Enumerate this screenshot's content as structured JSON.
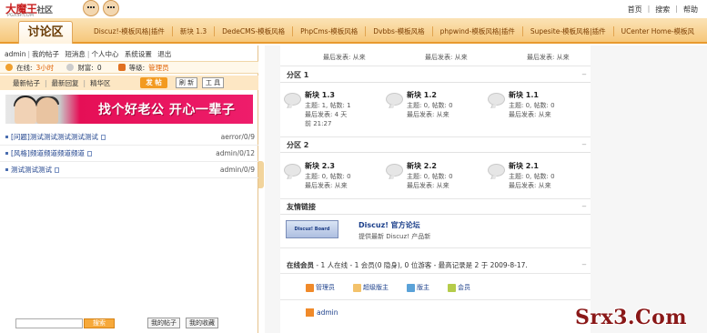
{
  "site": {
    "logo_text": "大魔王",
    "logo_sub": "社区",
    "logo_url": "PGXSP.COM",
    "top_links": [
      "首页",
      "搜索",
      "帮助"
    ]
  },
  "nav": {
    "home_tab": "讨论区",
    "items": [
      "Discuz!-模板风格|插件",
      "新块 1.3",
      "DedeCMS-模板风格",
      "PhpCms-模板风格",
      "Dvbbs-模板风格",
      "phpwind-模板风格|插件",
      "Supesite-模板风格|插件",
      "UCenter Home-模板风"
    ]
  },
  "sidebar": {
    "user_links": [
      "admin",
      "我的帖子",
      "短消息",
      "个人中心",
      "系统设置",
      "退出"
    ],
    "online_label": "在线:",
    "online_value": "3小时",
    "wealth_label": "财富:",
    "wealth_value": "0",
    "level_label": "等级:",
    "level_value": "管理员",
    "tabs": [
      "最新帖子",
      "最新回复",
      "精华区"
    ],
    "post_button": "发 帖",
    "refresh_button": "刷 新",
    "tools_button": "工 具",
    "banner_slogan": "找个好老公 开心一辈子",
    "threads": [
      {
        "title": "[问题]测试测试测试测试测试",
        "author": "aerror/0/9"
      },
      {
        "title": "[风格]频道频道频道频道",
        "author": "admin/0/12"
      },
      {
        "title": "测试测试测试",
        "author": "admin/0/9"
      }
    ],
    "search_placeholder": "",
    "search_button": "搜索",
    "my_posts_button": "我的帖子",
    "my_favorites_button": "我的收藏"
  },
  "content": {
    "top_rows": [
      {
        "line1": "最后发表: 从来"
      },
      {
        "line1": "最后发表: 从来"
      },
      {
        "line1": "最后发表: 从来"
      }
    ],
    "sections": [
      {
        "title": "分区 1",
        "forums": [
          {
            "name": "新块 1.3",
            "stats": "主题: 1, 帖数: 1",
            "last": "最后发表: 4 天",
            "extra": "前 21:27"
          },
          {
            "name": "新块 1.2",
            "stats": "主题: 0, 帖数: 0",
            "last": "最后发表: 从来",
            "extra": ""
          },
          {
            "name": "新块 1.1",
            "stats": "主题: 0, 帖数: 0",
            "last": "最后发表: 从来",
            "extra": ""
          }
        ]
      },
      {
        "title": "分区 2",
        "forums": [
          {
            "name": "新块 2.3",
            "stats": "主题: 0, 帖数: 0",
            "last": "最后发表: 从来",
            "extra": ""
          },
          {
            "name": "新块 2.2",
            "stats": "主题: 0, 帖数: 0",
            "last": "最后发表: 从来",
            "extra": ""
          },
          {
            "name": "新块 2.1",
            "stats": "主题: 0, 帖数: 0",
            "last": "最后发表: 从来",
            "extra": ""
          }
        ]
      }
    ],
    "collapse_glyph": "−",
    "links_title": "友情链接",
    "link_banner": "Discuz! Board",
    "link_name": "Discuz! 官方论坛",
    "link_desc": "提供最新 Discuz! 产品新",
    "online_title": "在线会员",
    "online_text": "- 1 人在线 - 1 会员(0 隐身), 0 位游客 - 最高记录是 2 于 2009-8-17.",
    "legend": [
      {
        "label": "管理员",
        "color": "#f08a2a"
      },
      {
        "label": "超级版主",
        "color": "#f3c26b"
      },
      {
        "label": "版主",
        "color": "#5aa2d8"
      },
      {
        "label": "会员",
        "color": "#b5cc4a"
      }
    ],
    "member_name": "admin"
  },
  "watermark": "Srx3.Com"
}
